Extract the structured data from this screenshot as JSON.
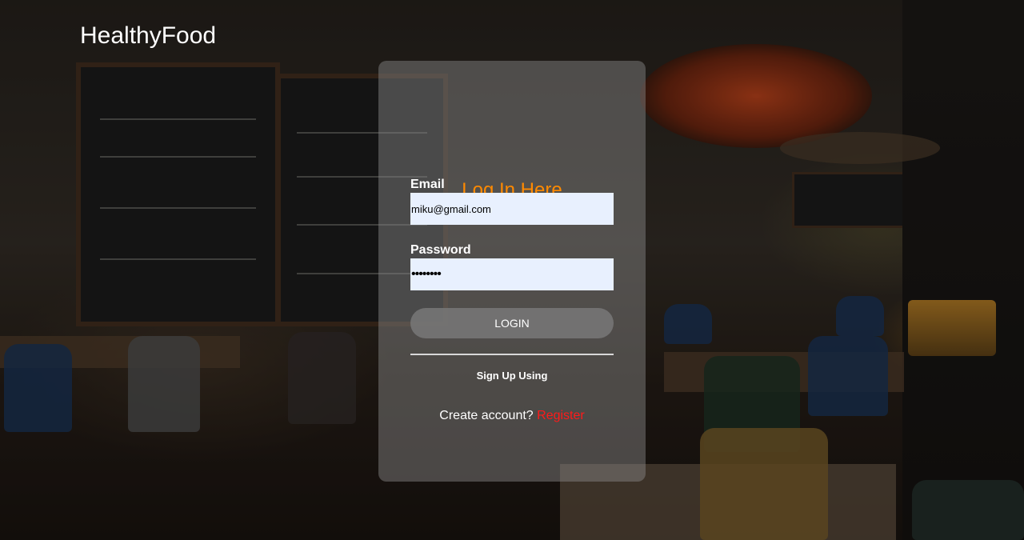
{
  "brand": {
    "name": "HealthyFood"
  },
  "login_form": {
    "title": "Log In Here",
    "email": {
      "label": "Email",
      "value": "miku@gmail.com"
    },
    "password": {
      "label": "Password",
      "masked_value": "••••••••"
    },
    "login_button": "LOGIN",
    "signup_using": "Sign Up Using",
    "create_account": {
      "prompt": "Create account?",
      "link_text": "Register"
    }
  },
  "colors": {
    "title_accent": "#ff8a00",
    "register_link": "#ff1a1a",
    "input_background": "#e8f0fe"
  }
}
